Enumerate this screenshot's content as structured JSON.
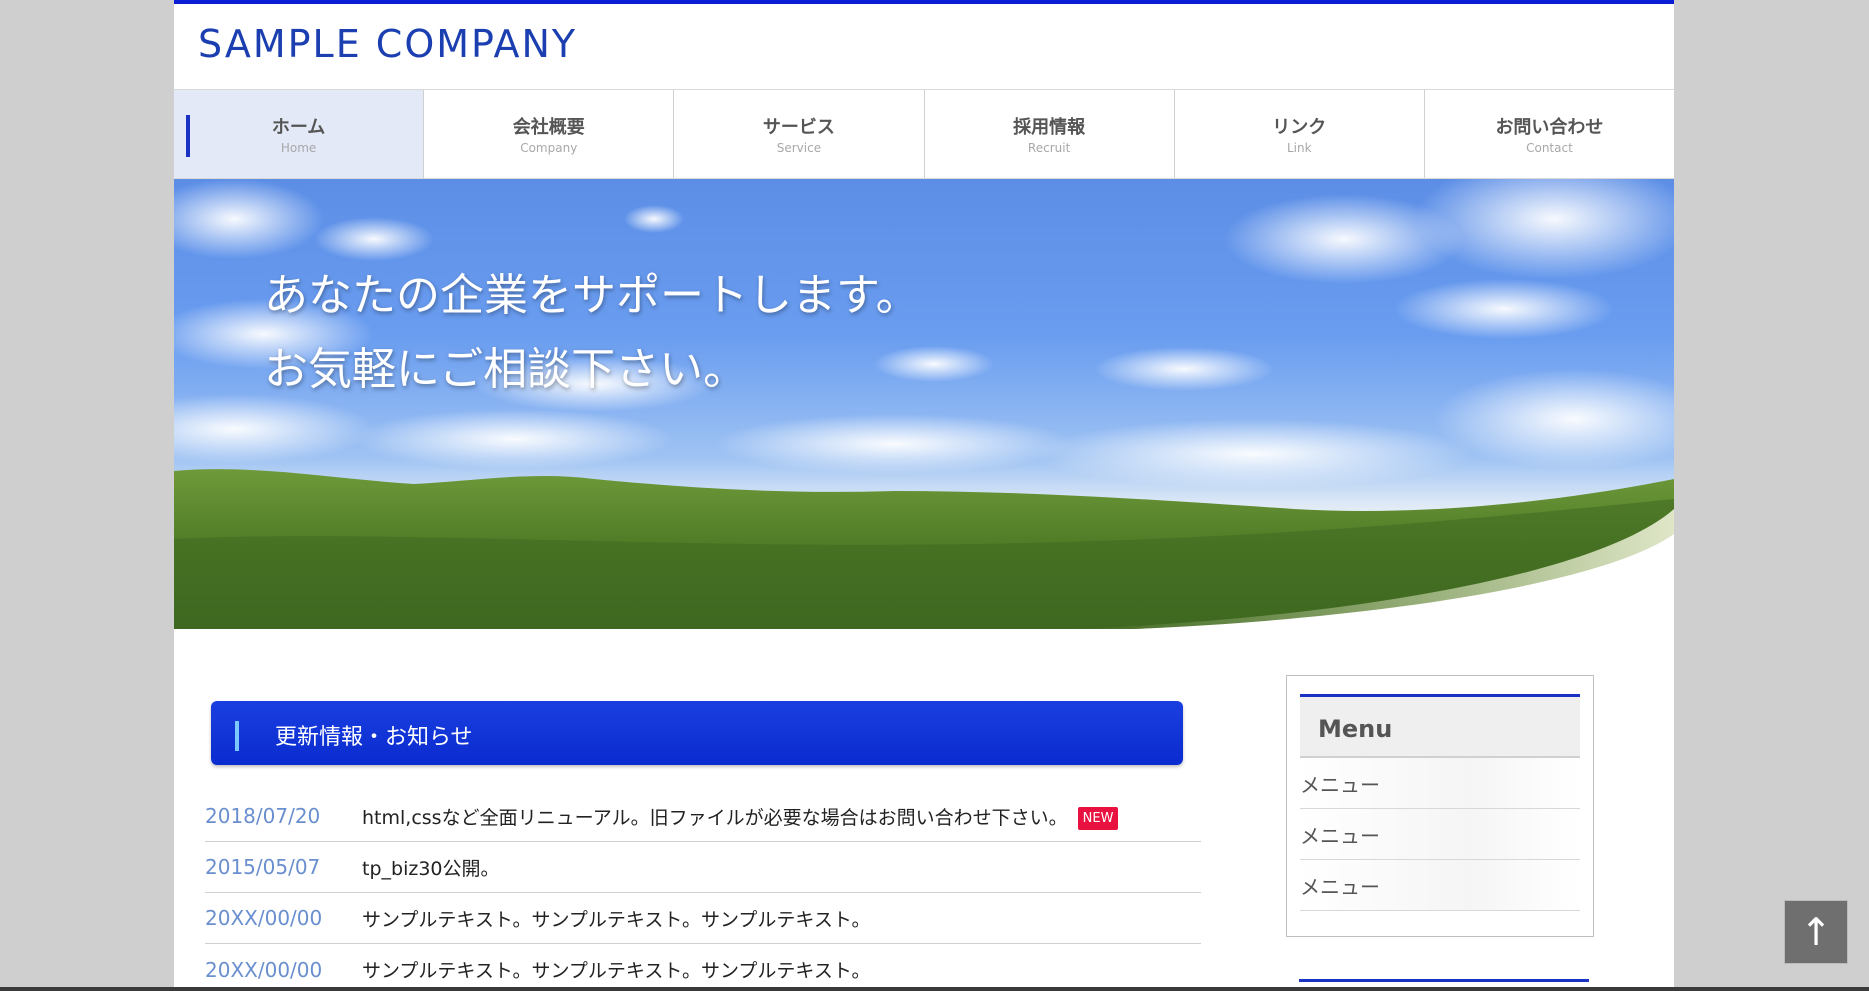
{
  "header": {
    "logo_text": "SAMPLE COMPANY"
  },
  "nav": {
    "items": [
      {
        "label": "ホーム",
        "sub": "Home",
        "active": true
      },
      {
        "label": "会社概要",
        "sub": "Company"
      },
      {
        "label": "サービス",
        "sub": "Service"
      },
      {
        "label": "採用情報",
        "sub": "Recruit"
      },
      {
        "label": "リンク",
        "sub": "Link"
      },
      {
        "label": "お問い合わせ",
        "sub": "Contact"
      }
    ]
  },
  "hero": {
    "line1": "あなたの企業をサポートします。",
    "line2": "お気軽にご相談下さい。"
  },
  "news": {
    "title": "更新情報・お知らせ",
    "badge_new": "NEW",
    "items": [
      {
        "date": "2018/07/20",
        "text": "html,cssなど全面リニューアル。旧ファイルが必要な場合はお問い合わせ下さい。"
      },
      {
        "date": "2015/05/07",
        "text": "tp_biz30公開。"
      },
      {
        "date": "20XX/00/00",
        "text": "サンプルテキスト。サンプルテキスト。サンプルテキスト。"
      },
      {
        "date": "20XX/00/00",
        "text": "サンプルテキスト。サンプルテキスト。サンプルテキスト。"
      }
    ]
  },
  "sidebar": {
    "title": "Menu",
    "items": [
      "メニュー",
      "メニュー",
      "メニュー"
    ]
  },
  "pagetop": {
    "icon": "arrow-up-icon",
    "glyph": "↑"
  },
  "colors": {
    "accent": "#0a1ed6",
    "logo": "#1b3fb0",
    "news_head": "#0a2bcf",
    "badge": "#e8113f"
  }
}
